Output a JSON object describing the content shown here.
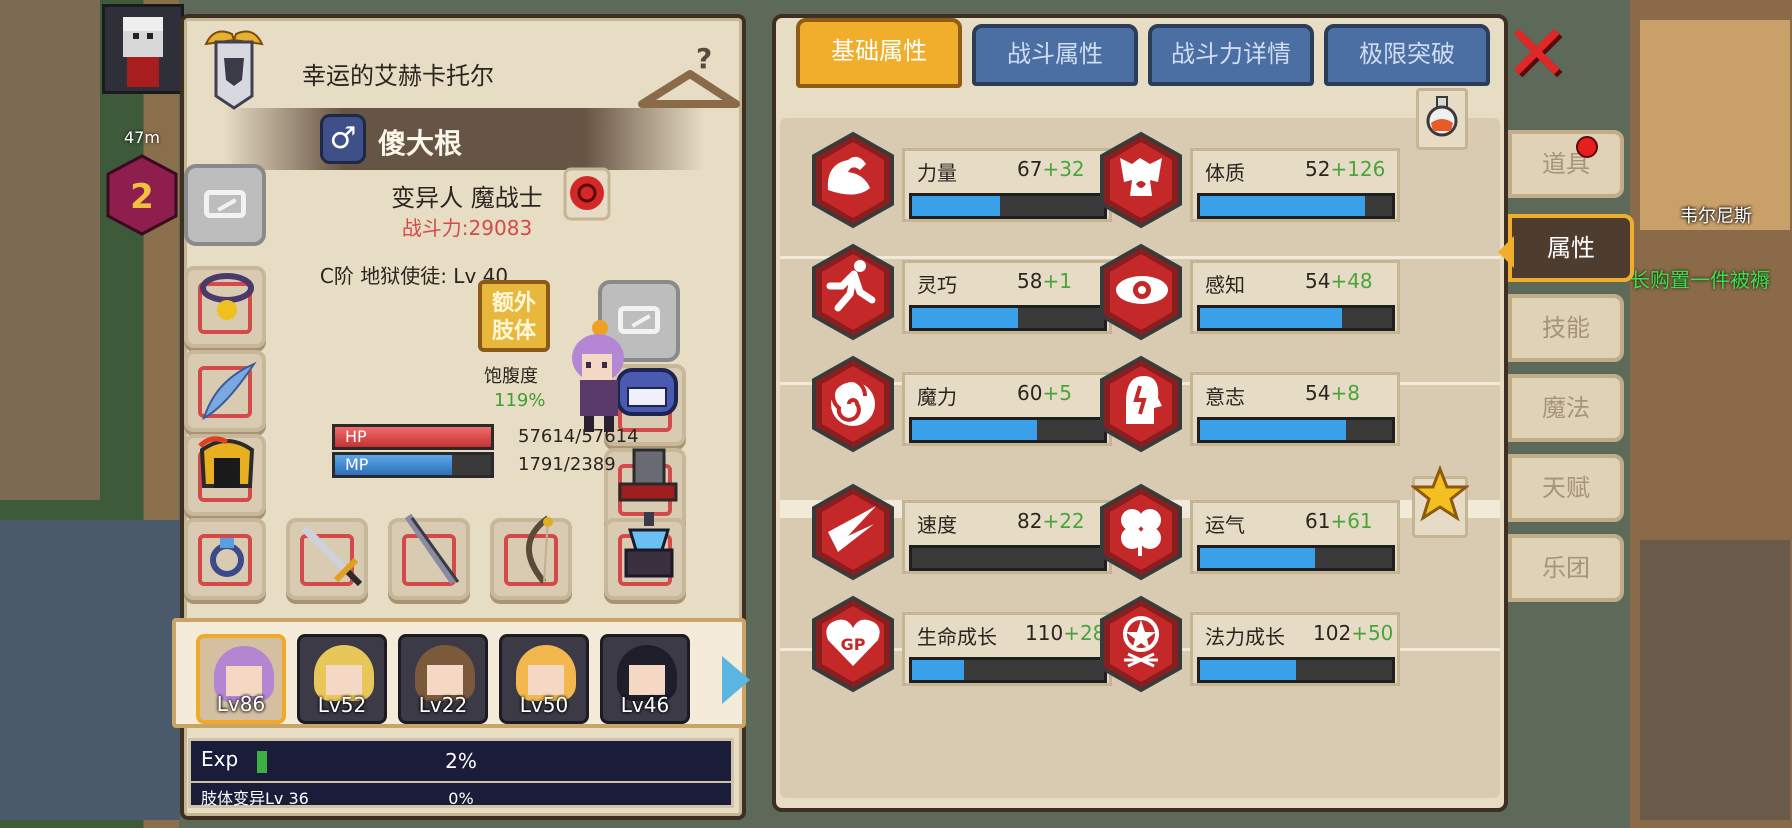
{
  "character": {
    "title": "幸运的艾赫卡托尔",
    "gender_symbol": "♂",
    "name": "傻大根",
    "class": "变异人 魔战士",
    "power": "战斗力:29083",
    "rank_line": "C阶 地狱使徒: Lv 40",
    "extra_limb_label": "额外\n肢体",
    "hunger_label": "饱腹度",
    "hunger_value": "119%",
    "hp_label": "HP",
    "hp_text": "57614/57614",
    "hp_fraction": 1.0,
    "mp_label": "MP",
    "mp_text": "1791/2389",
    "mp_fraction": 0.75
  },
  "party": [
    {
      "level": "Lv86",
      "selected": true,
      "hair": "#b485d0"
    },
    {
      "level": "Lv52",
      "selected": false,
      "hair": "#e8c75a"
    },
    {
      "level": "Lv22",
      "selected": false,
      "hair": "#7a5a3a"
    },
    {
      "level": "Lv50",
      "selected": false,
      "hair": "#f2b84e"
    },
    {
      "level": "Lv46",
      "selected": false,
      "hair": "#1e1e2a"
    }
  ],
  "exp": {
    "label": "Exp",
    "percent": "2%",
    "fraction": 0.02,
    "limb_label": "肢体变异Lv 36",
    "limb_percent": "0%"
  },
  "tabs": [
    {
      "label": "基础属性",
      "active": true
    },
    {
      "label": "战斗属性",
      "active": false
    },
    {
      "label": "战斗力详情",
      "active": false
    },
    {
      "label": "极限突破",
      "active": false
    }
  ],
  "stats": [
    {
      "name": "力量",
      "base": "67",
      "bonus": "+32",
      "fraction": 0.46,
      "icon": "muscle-icon"
    },
    {
      "name": "体质",
      "base": "52",
      "bonus": "+126",
      "fraction": 0.86,
      "icon": "body-icon"
    },
    {
      "name": "灵巧",
      "base": "58",
      "bonus": "+1",
      "fraction": 0.55,
      "icon": "running-icon"
    },
    {
      "name": "感知",
      "base": "54",
      "bonus": "+48",
      "fraction": 0.74,
      "icon": "eye-icon"
    },
    {
      "name": "魔力",
      "base": "60",
      "bonus": "+5",
      "fraction": 0.65,
      "icon": "swirl-icon"
    },
    {
      "name": "意志",
      "base": "54",
      "bonus": "+8",
      "fraction": 0.76,
      "icon": "head-icon"
    },
    {
      "name": "速度",
      "base": "82",
      "bonus": "+22",
      "fraction": 0.0,
      "icon": "speed-icon"
    },
    {
      "name": "运气",
      "base": "61",
      "bonus": "+61",
      "fraction": 0.6,
      "icon": "clover-icon"
    },
    {
      "name": "生命成长",
      "base": "110",
      "bonus": "+28",
      "fraction": 0.27,
      "icon": "heart-icon"
    },
    {
      "name": "法力成长",
      "base": "102",
      "bonus": "+50",
      "fraction": 0.5,
      "icon": "pentagram-icon"
    }
  ],
  "side_menu": [
    {
      "label": "道具",
      "active": false
    },
    {
      "label": "属性",
      "active": true
    },
    {
      "label": "技能",
      "active": false
    },
    {
      "label": "魔法",
      "active": false
    },
    {
      "label": "天赋",
      "active": false
    },
    {
      "label": "乐团",
      "active": false
    }
  ],
  "map": {
    "location_label": "韦尔尼斯",
    "notice_text": "长购置一件被褥",
    "distance": "47m",
    "level_badge": "2"
  },
  "colors": {
    "accent": "#f0ae2c",
    "bonus_green": "#4aa43c",
    "power_red": "#d24b47",
    "stat_bar_blue": "#3aa0ea"
  }
}
